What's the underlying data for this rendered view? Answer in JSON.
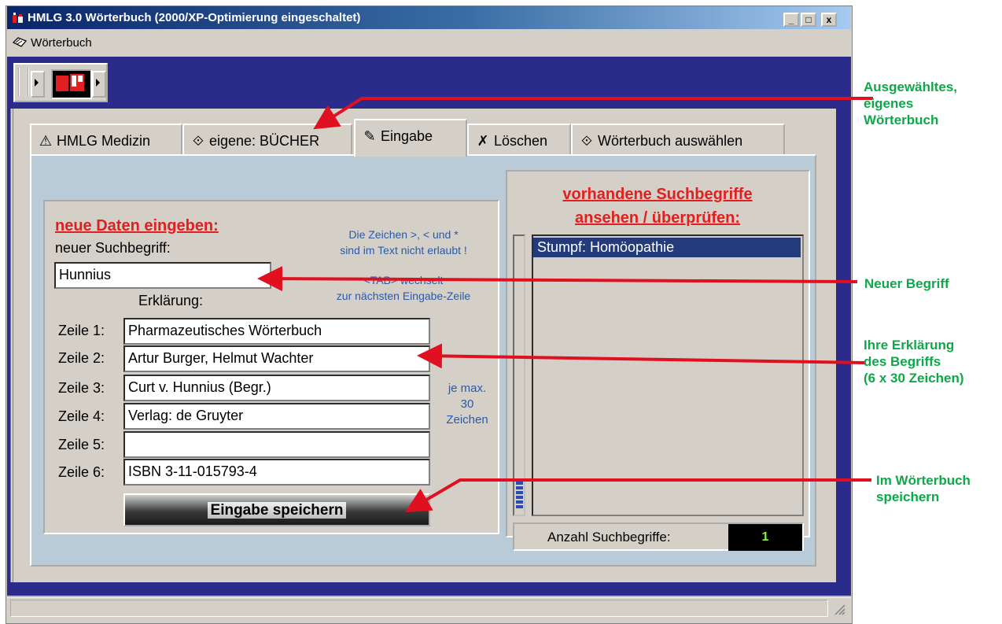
{
  "window": {
    "title": "HMLG 3.0 Wörterbuch (2000/XP-Optimierung eingeschaltet)",
    "controls": {
      "minimize": "_",
      "maximize": "□",
      "close": "x"
    }
  },
  "menu": {
    "items": [
      {
        "label": "Wörterbuch",
        "icon": "book-icon"
      }
    ]
  },
  "tabs": [
    {
      "label": "HMLG Medizin",
      "icon": "warning-people-icon"
    },
    {
      "label": "eigene: BÜCHER",
      "icon": "book-icon"
    },
    {
      "label": "Eingabe",
      "icon": "notepad-edit-icon",
      "active": true
    },
    {
      "label": "Löschen",
      "icon": "eraser-icon"
    },
    {
      "label": "Wörterbuch auswählen",
      "icon": "book-icon"
    }
  ],
  "form": {
    "heading": "neue Daten eingeben:",
    "search_label": "neuer Suchbegriff:",
    "search_value": "Hunnius",
    "hint_chars": [
      "Die Zeichen >, < und *",
      "sind im Text nicht erlaubt !"
    ],
    "hint_tab": [
      "<TAB> wechselt",
      "zur nächsten Eingabe-Zeile"
    ],
    "explanation_label": "Erklärung:",
    "lines": [
      {
        "label": "Zeile 1:",
        "value": "Pharmazeutisches Wörterbuch"
      },
      {
        "label": "Zeile 2:",
        "value": "Artur Burger, Helmut Wachter"
      },
      {
        "label": "Zeile 3:",
        "value": "Curt v. Hunnius (Begr.)"
      },
      {
        "label": "Zeile 4:",
        "value": "Verlag: de Gruyter"
      },
      {
        "label": "Zeile 5:",
        "value": ""
      },
      {
        "label": "Zeile 6:",
        "value": "ISBN 3-11-015793-4"
      }
    ],
    "max_hint": [
      "je max.",
      "30",
      "Zeichen"
    ],
    "save_button": "Eingabe speichern"
  },
  "existing": {
    "heading": [
      "vorhandene Suchbegriffe",
      "ansehen / überprüfen:"
    ],
    "items": [
      "Stumpf: Homöopathie"
    ],
    "count_label": "Anzahl Suchbegriffe:",
    "count_value": "1"
  },
  "callouts": {
    "dictionary": [
      "Ausgewähltes,",
      "eigenes",
      "Wörterbuch"
    ],
    "new_term": "Neuer Begriff",
    "explanation": [
      "Ihre Erklärung",
      "des Begriffs",
      "(6 x 30 Zeichen)"
    ],
    "save": [
      "Im Wörterbuch",
      "speichern"
    ]
  },
  "colors": {
    "accent_red": "#e02020",
    "callout_green": "#0ea84a",
    "desktop_blue": "#2b2b8c",
    "hint_blue": "#2a5aa8",
    "selection_blue": "#233b7a",
    "count_green": "#8cf04a"
  }
}
